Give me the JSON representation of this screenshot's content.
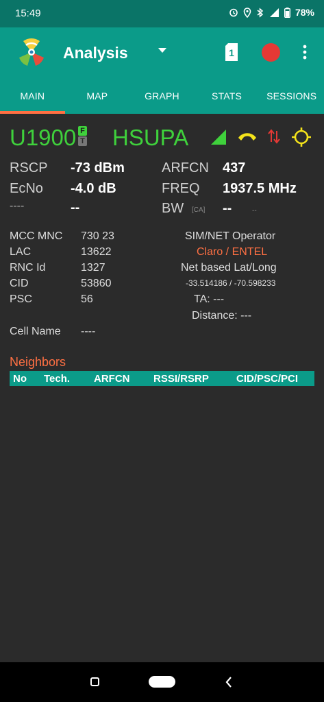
{
  "status_bar": {
    "time": "15:49",
    "battery": "78%",
    "icons": [
      "alarm-icon",
      "location-icon",
      "bluetooth-icon",
      "signal-roaming-icon",
      "battery-icon"
    ]
  },
  "app_bar": {
    "title": "Analysis",
    "sim_slot": "1",
    "colors": {
      "primary": "#0b9b89",
      "status": "#0a7467",
      "accent": "#ff7043",
      "record": "#e53935"
    }
  },
  "tabs": [
    {
      "label": "MAIN",
      "active": true
    },
    {
      "label": "MAP",
      "active": false
    },
    {
      "label": "GRAPH",
      "active": false
    },
    {
      "label": "STATS",
      "active": false
    },
    {
      "label": "SESSIONS",
      "active": false
    }
  ],
  "serving": {
    "band": "U1900",
    "badge_f": "F",
    "badge_t": "T",
    "technology": "HSUPA",
    "tech_color": "#3fd13c"
  },
  "metrics": {
    "rscp_label": "RSCP",
    "rscp_value": "-73 dBm",
    "ecno_label": "EcNo",
    "ecno_value": "-4.0 dB",
    "extra_label": "----",
    "extra_value": "--",
    "arfcn_label": "ARFCN",
    "arfcn_value": "437",
    "freq_label": "FREQ",
    "freq_value": "1937.5 MHz",
    "bw_label": "BW",
    "bw_ca": "[CA]",
    "bw_value": "--",
    "bw_unit": "--"
  },
  "cell_info": {
    "mcc_mnc_label": "MCC MNC",
    "mcc_mnc_value": "730 23",
    "lac_label": "LAC",
    "lac_value": "13622",
    "rnc_label": "RNC Id",
    "rnc_value": "1327",
    "cid_label": "CID",
    "cid_value": "53860",
    "psc_label": "PSC",
    "psc_value": "56",
    "cell_name_label": "Cell Name",
    "cell_name_value": "----"
  },
  "operator_info": {
    "sim_net_label": "SIM/NET Operator",
    "operator_name": "Claro / ENTEL",
    "latlong_label": "Net based Lat/Long",
    "latlong_value": "-33.514186 / -70.598233",
    "ta": "TA: ---",
    "distance": "Distance: ---"
  },
  "neighbors": {
    "title": "Neighbors",
    "columns": [
      "No",
      "Tech.",
      "ARFCN",
      "RSSI/RSRP",
      "CID/PSC/PCI"
    ]
  }
}
